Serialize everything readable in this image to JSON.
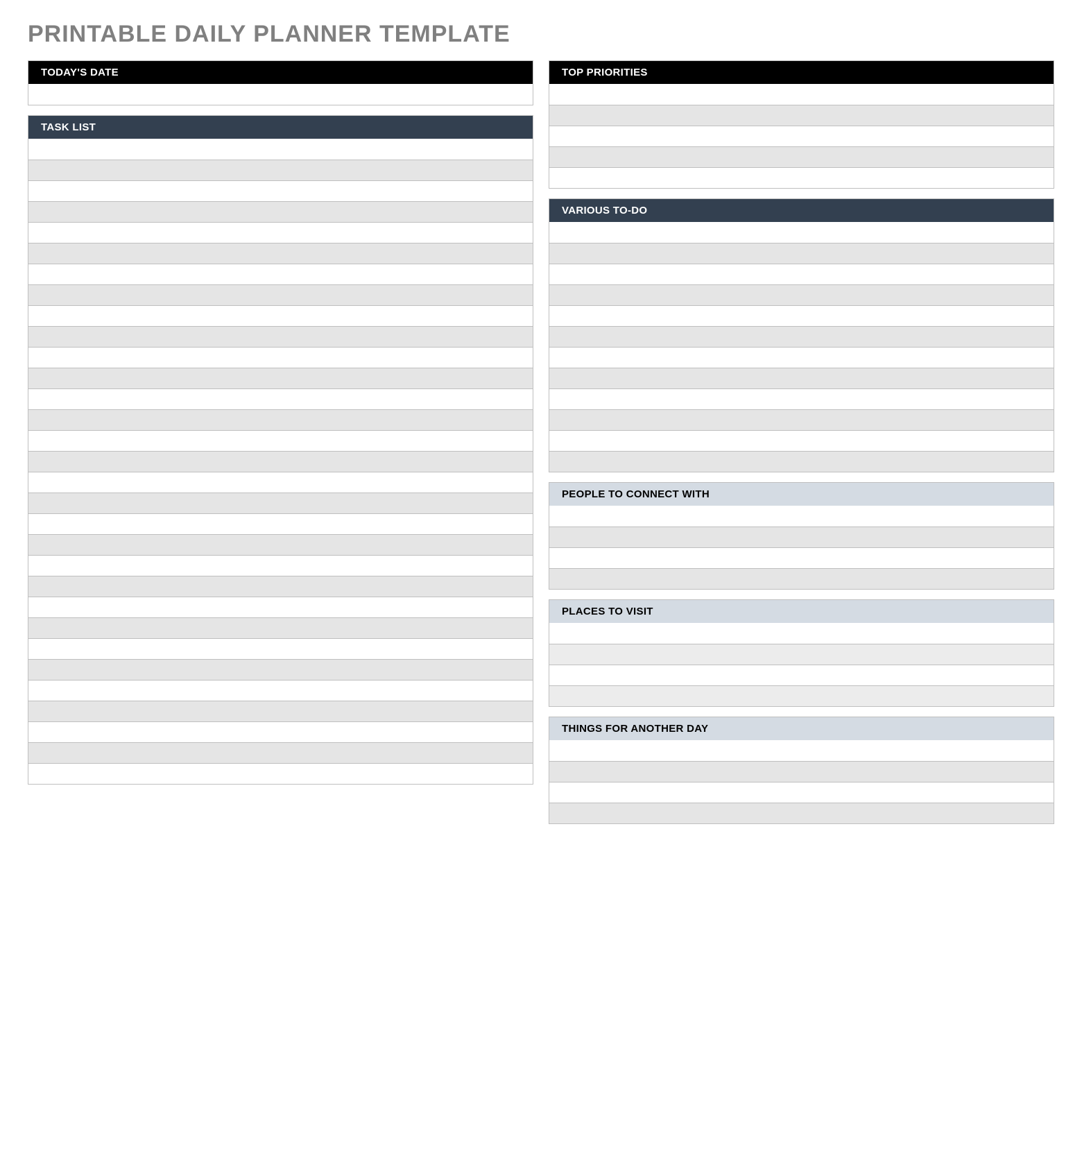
{
  "title": "PRINTABLE DAILY PLANNER TEMPLATE",
  "left": {
    "todaysDate": {
      "label": "TODAY'S DATE",
      "rows": 1
    },
    "taskList": {
      "label": "TASK LIST",
      "rows": 31
    }
  },
  "right": {
    "topPriorities": {
      "label": "TOP PRIORITIES",
      "rows": 5
    },
    "variousTodo": {
      "label": "VARIOUS TO-DO",
      "rows": 12
    },
    "peopleConnect": {
      "label": "PEOPLE TO CONNECT WITH",
      "rows": 4
    },
    "placesVisit": {
      "label": "PLACES TO VISIT",
      "rows": 4
    },
    "anotherDay": {
      "label": "THINGS FOR ANOTHER DAY",
      "rows": 4
    }
  }
}
